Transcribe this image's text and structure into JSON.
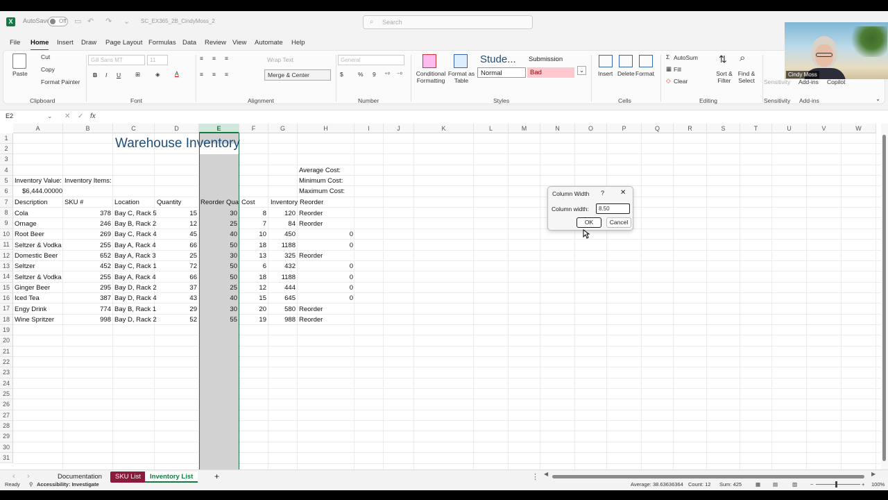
{
  "titlebar": {
    "autosave_label": "AutoSave",
    "autosave_state": "Off",
    "doc_name": "SC_EX365_2B_CindyMoss_2",
    "search_placeholder": "Search"
  },
  "menu": {
    "items": [
      "File",
      "Home",
      "Insert",
      "Draw",
      "Page Layout",
      "Formulas",
      "Data",
      "Review",
      "View",
      "Automate",
      "Help"
    ],
    "active": "Home"
  },
  "ribbon": {
    "clipboard": {
      "paste": "Paste",
      "cut": "Cut",
      "copy": "Copy",
      "format_painter": "Format Painter",
      "label": "Clipboard"
    },
    "font": {
      "name": "Gill Sans MT",
      "size": "11",
      "label": "Font"
    },
    "alignment": {
      "wrap_text": "Wrap Text",
      "merge_center": "Merge & Center",
      "label": "Alignment"
    },
    "number": {
      "format": "General",
      "label": "Number"
    },
    "styles": {
      "conditional": "Conditional Formatting",
      "format_table": "Format as Table",
      "style1": "Stude...",
      "style2": "Submission",
      "normal": "Normal",
      "bad": "Bad",
      "label": "Styles"
    },
    "cells": {
      "insert": "Insert",
      "delete": "Delete",
      "format": "Format",
      "label": "Cells"
    },
    "editing": {
      "autosum": "AutoSum",
      "fill": "Fill",
      "clear": "Clear",
      "sort_filter": "Sort & Filter",
      "find_select": "Find & Select",
      "label": "Editing"
    },
    "sensitivity": {
      "label": "Sensitivity",
      "btn": "Sensitivity"
    },
    "addins": {
      "label": "Add-ins",
      "btn": "Add-ins",
      "copilot": "Copilot"
    }
  },
  "formula_bar": {
    "name_box": "E2",
    "fx": "fx",
    "formula": ""
  },
  "columns": [
    "A",
    "B",
    "C",
    "D",
    "E",
    "F",
    "G",
    "H",
    "I",
    "J",
    "K",
    "L",
    "M",
    "N",
    "O",
    "P",
    "Q",
    "R",
    "S",
    "T",
    "U",
    "V",
    "W"
  ],
  "selected_column": "E",
  "rows": [
    "1",
    "2",
    "3",
    "4",
    "5",
    "6",
    "7",
    "8",
    "9",
    "10",
    "11",
    "12",
    "13",
    "14",
    "15",
    "16",
    "17",
    "18",
    "19",
    "20",
    "21",
    "22",
    "23",
    "24",
    "25",
    "26",
    "27",
    "28",
    "29",
    "30",
    "31"
  ],
  "sheet": {
    "title": "Warehouse Inventory",
    "labels": {
      "inventory_value": "Inventory Value:",
      "inventory_items": "Inventory Items:",
      "inventory_value_amount": "$6,444.00000",
      "average_cost": "Average Cost:",
      "minimum_cost": "Minimum Cost:",
      "maximum_cost": "Maximum Cost:"
    },
    "headers": [
      "Description",
      "SKU #",
      "Location",
      "Quantity",
      "Reorder Qua",
      "Cost",
      "Inventory",
      "Reorder"
    ],
    "data": [
      [
        "Cola",
        "378",
        "Bay C, Rack 5",
        "15",
        "30",
        "8",
        "120",
        "Reorder"
      ],
      [
        "Ornage",
        "246",
        "Bay B, Rack 2",
        "12",
        "25",
        "7",
        "84",
        "Reorder"
      ],
      [
        "Root Beer",
        "269",
        "Bay C, Rack 4",
        "45",
        "40",
        "10",
        "450",
        "0"
      ],
      [
        "Seltzer & Vodka",
        "255",
        "Bay A, Rack 4",
        "66",
        "50",
        "18",
        "1188",
        "0"
      ],
      [
        "Domestic Beer",
        "652",
        "Bay A, Rack 3",
        "25",
        "30",
        "13",
        "325",
        "Reorder"
      ],
      [
        "Seltzer",
        "452",
        "Bay C, Rack 1",
        "72",
        "50",
        "6",
        "432",
        "0"
      ],
      [
        "Seltzer & Vodka",
        "255",
        "Bay A, Rack 4",
        "66",
        "50",
        "18",
        "1188",
        "0"
      ],
      [
        "Ginger Beer",
        "295",
        "Bay D, Rack 2",
        "37",
        "25",
        "12",
        "444",
        "0"
      ],
      [
        "Iced Tea",
        "387",
        "Bay D, Rack 4",
        "43",
        "40",
        "15",
        "645",
        "0"
      ],
      [
        "Engy Drink",
        "774",
        "Bay B, Rack 1",
        "29",
        "30",
        "20",
        "580",
        "Reorder"
      ],
      [
        "Wine Spritzer",
        "998",
        "Bay D, Rack 2",
        "52",
        "55",
        "19",
        "988",
        "Reorder"
      ]
    ]
  },
  "dialog": {
    "title": "Column Width",
    "help": "?",
    "close": "✕",
    "label": "Column width:",
    "value": "8.50",
    "ok": "OK",
    "cancel": "Cancel"
  },
  "tabs": {
    "items": [
      "Documentation",
      "SKU List",
      "Inventory List"
    ],
    "active": "Inventory List",
    "sku_color": "#8b1a3d",
    "add": "+"
  },
  "status": {
    "ready": "Ready",
    "accessibility": "Accessibility: Investigate",
    "average": "Average: 38.63636364",
    "count": "Count: 12",
    "sum": "Sum: 425",
    "zoom": "100%"
  },
  "video": {
    "name": "Cindy Moss"
  },
  "colors": {
    "accent": "#107c41",
    "title": "#1f4e79",
    "bad_bg": "#ffc7ce",
    "bad_fg": "#9c0006"
  }
}
